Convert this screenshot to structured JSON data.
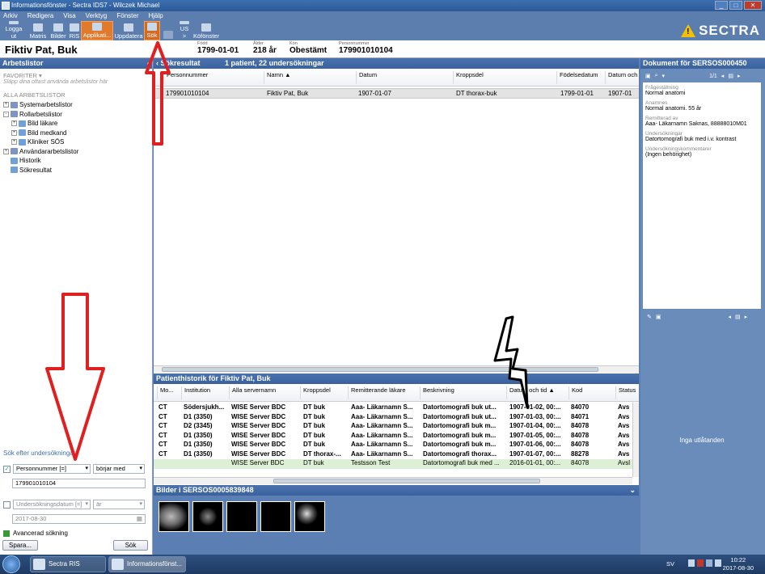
{
  "window": {
    "title": "Informationsfönster - Sectra IDS7 - Wilczek Michael"
  },
  "menu": [
    "Arkiv",
    "Redigera",
    "Visa",
    "Verktyg",
    "Fönster",
    "Hjälp"
  ],
  "toolbar": [
    {
      "label": "Logga ut",
      "icon": "logout-icon"
    },
    {
      "label": "Matris",
      "icon": "matrix-icon"
    },
    {
      "label": "Bilder",
      "icon": "images-icon"
    },
    {
      "label": "RIS",
      "icon": "ris-icon"
    },
    {
      "label": "Applikati...",
      "icon": "application-icon"
    },
    {
      "label": "Uppdatera",
      "icon": "refresh-icon"
    },
    {
      "label": "Sök",
      "icon": "search-icon"
    },
    {
      "label": "",
      "icon": "undo-icon"
    },
    {
      "label": "US >",
      "icon": "us-icon"
    },
    {
      "label": "Köfönster",
      "icon": "queue-icon"
    }
  ],
  "brand": "SECTRA",
  "patient": {
    "name": "Fiktiv Pat, Buk",
    "fields": [
      {
        "label": "Född",
        "value": "1799-01-01"
      },
      {
        "label": "Ålder",
        "value": "218 år"
      },
      {
        "label": "Kön",
        "value": "Obestämt"
      },
      {
        "label": "Personnummer",
        "value": "179901010104"
      }
    ]
  },
  "left": {
    "header": "Arbetslistor",
    "favorites_label": "FAVORITER",
    "favorites_hint": "Släpp dina oftast använda arbetslistor här",
    "all_label": "ALLA ARBETSLISTOR",
    "tree": [
      {
        "label": "Systemarbetslistor",
        "level": 0,
        "expander": "+"
      },
      {
        "label": "Rollarbetslistor",
        "level": 0,
        "expander": "-"
      },
      {
        "label": "Bild läkare",
        "level": 1,
        "expander": "+"
      },
      {
        "label": "Bild medkand",
        "level": 1,
        "expander": "+"
      },
      {
        "label": "Kliniker SÖS",
        "level": 1,
        "expander": "+"
      },
      {
        "label": "Användararbetslistor",
        "level": 0,
        "expander": "+"
      },
      {
        "label": "Historik",
        "level": 0,
        "expander": ""
      },
      {
        "label": "Sökresultat",
        "level": 0,
        "expander": ""
      }
    ],
    "search": {
      "title": "Sök efter undersökningar",
      "field1": "Personnummer [=]",
      "op1": "börjar med",
      "value1": "179901010104",
      "field2": "Undersökningsdatum [=]",
      "op2": "är",
      "value2": "2017-08-30",
      "advanced": "Avancerad sökning",
      "save": "Spara...",
      "search_btn": "Sök"
    }
  },
  "results": {
    "header": "Sökresultat",
    "summary": "1 patient, 22 undersökningar",
    "columns": [
      "Personnummer",
      "Namn",
      "Datum",
      "Kroppsdel",
      "Födelsedatum",
      "Datum och"
    ],
    "rows": [
      [
        "179901010104",
        "Fiktiv Pat, Buk",
        "1907-01-07",
        "DT thorax-buk",
        "1799-01-01",
        "1907-01"
      ]
    ]
  },
  "history": {
    "header": "Patienthistorik för Fiktiv Pat, Buk",
    "columns": [
      "Mo...",
      "Institution",
      "Alla servernamn",
      "Kroppsdel",
      "Remitterande läkare",
      "Beskrivning",
      "Datum och tid",
      "Kod",
      "Status"
    ],
    "rows": [
      [
        "CT",
        "Södersjukh...",
        "WISE Server BDC",
        "DT buk",
        "Aaa- Läkarnamn S...",
        "Datortomografi buk ut...",
        "1907-01-02, 00:...",
        "84070",
        "Avs"
      ],
      [
        "CT",
        "D1 (3350)",
        "WISE Server BDC",
        "DT buk",
        "Aaa- Läkarnamn S...",
        "Datortomografi buk ut...",
        "1907-01-03, 00:...",
        "84071",
        "Avs"
      ],
      [
        "CT",
        "D2 (3345)",
        "WISE Server BDC",
        "DT buk",
        "Aaa- Läkarnamn S...",
        "Datortomografi buk m...",
        "1907-01-04, 00:...",
        "84078",
        "Avs"
      ],
      [
        "CT",
        "D1 (3350)",
        "WISE Server BDC",
        "DT buk",
        "Aaa- Läkarnamn S...",
        "Datortomografi buk m...",
        "1907-01-05, 00:...",
        "84078",
        "Avs"
      ],
      [
        "CT",
        "D1 (3350)",
        "WISE Server BDC",
        "DT buk",
        "Aaa- Läkarnamn S...",
        "Datortomografi buk m...",
        "1907-01-06, 00:...",
        "84078",
        "Avs"
      ],
      [
        "CT",
        "D1 (3350)",
        "WISE Server BDC",
        "DT thorax-...",
        "Aaa- Läkarnamn S...",
        "Datortomografi thorax...",
        "1907-01-07, 00:...",
        "88278",
        "Avs"
      ],
      [
        "",
        "",
        "WISE Server BDC",
        "DT buk",
        "Testsson Test",
        "Datortomografi buk med ...",
        "2016-01-01, 00:...",
        "84078",
        "Avsl"
      ]
    ]
  },
  "images": {
    "header": "Bilder i SERSOS0005839848",
    "count": 5
  },
  "document": {
    "header": "Dokument för SERSOS000450",
    "page": "1/1",
    "fields": [
      {
        "label": "Frågeställning",
        "value": "Normal anatomi"
      },
      {
        "label": "Anamnes",
        "value": "Normal anatomi. 55 år"
      },
      {
        "label": "Remitterad av",
        "value": "Aaa- Läkarnamn Saknas, 88888010M01"
      },
      {
        "label": "Undersökningar",
        "value": "Datortomografi buk med i.v. kontrast"
      },
      {
        "label": "Undersökningskommentarer",
        "value": "(Ingen behörighet)"
      }
    ],
    "no_statements": "Inga utlåtanden"
  },
  "taskbar": {
    "tasks": [
      "Sectra RIS (Europe...",
      "Informationsfönst..."
    ],
    "lang": "SV",
    "time": "10:22",
    "date": "2017-08-30"
  },
  "colors": {
    "accent": "#3a62a0",
    "active": "#e07a2c",
    "annotation_red": "#e02020"
  }
}
